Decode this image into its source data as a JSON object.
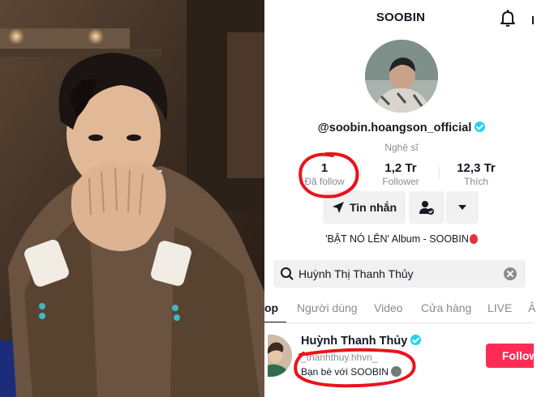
{
  "header": {
    "title": "SOOBIN"
  },
  "profile": {
    "handle": "@soobin.hoangson_official",
    "role": "Nghệ sĩ",
    "stats": {
      "following": {
        "value": "1",
        "label": "Đã follow"
      },
      "followers": {
        "value": "1,2 Tr",
        "label": "Follower"
      },
      "likes": {
        "value": "12,3 Tr",
        "label": "Thích"
      }
    },
    "message_label": "Tin nhắn",
    "bio": "'BẬT NÓ LÊN' Album - SOOBIN"
  },
  "search": {
    "query": "Huỳnh Thị Thanh Thủy"
  },
  "tabs": [
    {
      "label": "op",
      "active": true
    },
    {
      "label": "Người dùng",
      "active": false
    },
    {
      "label": "Video",
      "active": false
    },
    {
      "label": "Cửa hàng",
      "active": false
    },
    {
      "label": "LIVE",
      "active": false
    },
    {
      "label": "Â",
      "active": false
    }
  ],
  "result": {
    "name": "Huỳnh Thanh Thủy",
    "handle": "_thanhthuy.hhvn_",
    "friend_text": "Bạn bè với SOOBIN",
    "follow_label": "Follow"
  },
  "colors": {
    "accent_red": "#fe2c55",
    "verified": "#20d5ec",
    "annotation_red": "#e8141b"
  }
}
